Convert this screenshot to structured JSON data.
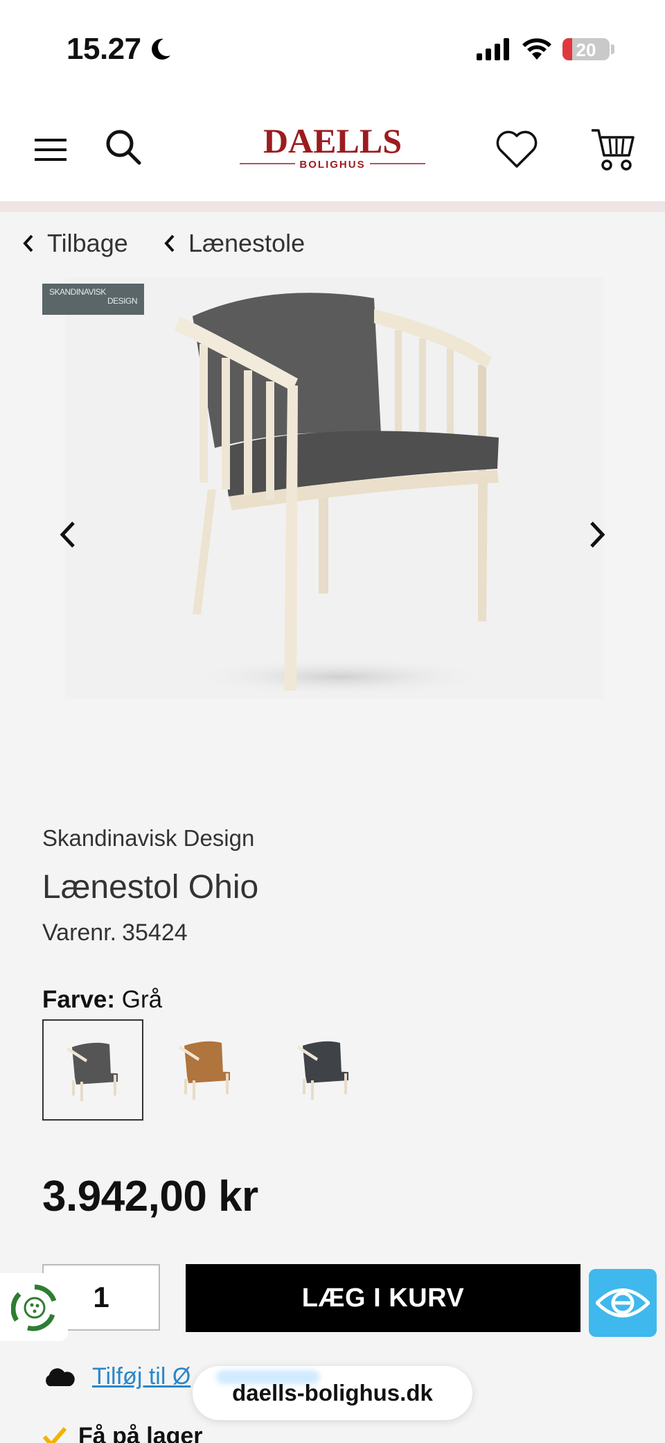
{
  "status_bar": {
    "time": "15.27",
    "battery": "20",
    "battery_level": 0.2
  },
  "header": {
    "logo_name": "DAELLS",
    "logo_sub": "BOLIGHUS",
    "brand_color": "#9b1c1f"
  },
  "breadcrumbs": [
    {
      "label": "Tilbage"
    },
    {
      "label": "Lænestole"
    }
  ],
  "gallery": {
    "brand_tag_line1": "SKANDINAVISK",
    "brand_tag_line2": "DESIGN"
  },
  "product": {
    "brand": "Skandinavisk Design",
    "title": "Lænestol Ohio",
    "sku_label": "Varenr.",
    "sku": "35424",
    "color_label": "Farve:",
    "color_value": "Grå",
    "swatches": [
      {
        "seat_color": "#555555",
        "selected": true
      },
      {
        "seat_color": "#b0743d",
        "selected": false
      },
      {
        "seat_color": "#3f4247",
        "selected": false
      }
    ],
    "price": "3.942,00 kr",
    "quantity": "1",
    "add_to_cart": "LÆG I KURV",
    "wishlist_link": "Tilføj til Ø",
    "stock_text": "Få på lager"
  },
  "browser": {
    "url": "daells-bolighus.dk"
  },
  "colors": {
    "link": "#2b87c8",
    "accessibility_button": "#3fb8ed",
    "stock_check": "#f2b300",
    "recycle_green": "#2e7d32"
  }
}
